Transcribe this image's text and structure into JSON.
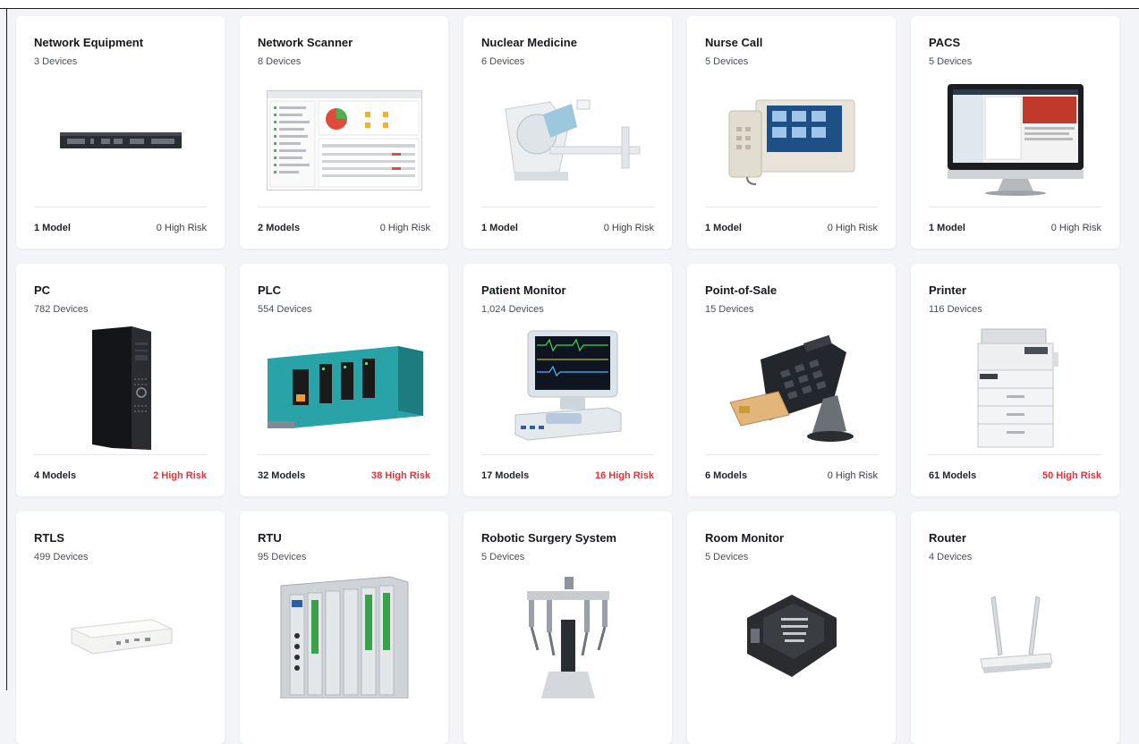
{
  "cards": [
    {
      "title": "Network Equipment",
      "devices": "3 Devices",
      "models": "1 Model",
      "risk": "0 High Risk",
      "risk_high": false,
      "icon": "network-switch-icon"
    },
    {
      "title": "Network Scanner",
      "devices": "8 Devices",
      "models": "2 Models",
      "risk": "0 High Risk",
      "risk_high": false,
      "icon": "dashboard-screenshot-icon"
    },
    {
      "title": "Nuclear Medicine",
      "devices": "6 Devices",
      "models": "1 Model",
      "risk": "0 High Risk",
      "risk_high": false,
      "icon": "scanner-machine-icon"
    },
    {
      "title": "Nurse Call",
      "devices": "5 Devices",
      "models": "1 Model",
      "risk": "0 High Risk",
      "risk_high": false,
      "icon": "nurse-call-station-icon"
    },
    {
      "title": "PACS",
      "devices": "5 Devices",
      "models": "1 Model",
      "risk": "0 High Risk",
      "risk_high": false,
      "icon": "monitor-workstation-icon"
    },
    {
      "title": "PC",
      "devices": "782 Devices",
      "models": "4 Models",
      "risk": "2 High Risk",
      "risk_high": true,
      "icon": "desktop-tower-icon"
    },
    {
      "title": "PLC",
      "devices": "554 Devices",
      "models": "32 Models",
      "risk": "38 High Risk",
      "risk_high": true,
      "icon": "plc-rack-icon"
    },
    {
      "title": "Patient Monitor",
      "devices": "1,024 Devices",
      "models": "17 Models",
      "risk": "16 High Risk",
      "risk_high": true,
      "icon": "patient-monitor-icon"
    },
    {
      "title": "Point-of-Sale",
      "devices": "15 Devices",
      "models": "6 Models",
      "risk": "0 High Risk",
      "risk_high": false,
      "icon": "card-terminal-icon"
    },
    {
      "title": "Printer",
      "devices": "116 Devices",
      "models": "61 Models",
      "risk": "50 High Risk",
      "risk_high": true,
      "icon": "office-printer-icon"
    },
    {
      "title": "RTLS",
      "devices": "499 Devices",
      "models": "",
      "risk": "",
      "risk_high": false,
      "icon": "rtls-reader-icon"
    },
    {
      "title": "RTU",
      "devices": "95 Devices",
      "models": "",
      "risk": "",
      "risk_high": false,
      "icon": "rtu-cabinet-icon"
    },
    {
      "title": "Robotic Surgery System",
      "devices": "5 Devices",
      "models": "",
      "risk": "",
      "risk_high": false,
      "icon": "surgical-robot-icon"
    },
    {
      "title": "Room Monitor",
      "devices": "5 Devices",
      "models": "",
      "risk": "",
      "risk_high": false,
      "icon": "room-monitor-box-icon"
    },
    {
      "title": "Router",
      "devices": "4 Devices",
      "models": "",
      "risk": "",
      "risk_high": false,
      "icon": "wifi-router-icon"
    }
  ],
  "colors": {
    "high_risk": "#e0353f",
    "background": "#f3f4f8"
  }
}
